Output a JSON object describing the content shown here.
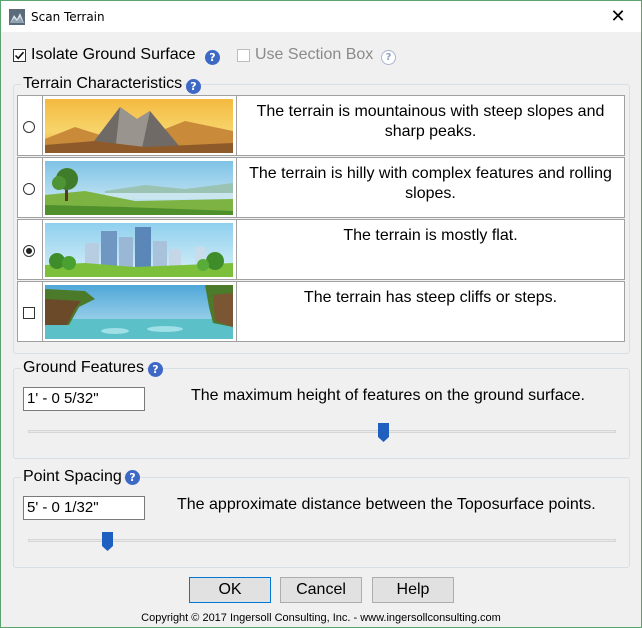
{
  "window": {
    "title": "Scan Terrain",
    "close_glyph": "✕"
  },
  "options": {
    "isolate_ground": {
      "label": "Isolate Ground Surface",
      "checked": true,
      "help": "?"
    },
    "section_box": {
      "label": "Use Section Box",
      "checked": false,
      "enabled": false,
      "help": "?"
    }
  },
  "terrain": {
    "legend": "Terrain Characteristics",
    "help": "?",
    "rows": [
      {
        "control": "radio",
        "selected": false,
        "image": "mountain-landscape",
        "description": "The terrain is mountainous with steep slopes and sharp peaks."
      },
      {
        "control": "radio",
        "selected": false,
        "image": "hill-landscape",
        "description": "The terrain is hilly with complex features and rolling slopes."
      },
      {
        "control": "radio",
        "selected": true,
        "image": "city-landscape",
        "description": "The terrain is mostly flat."
      },
      {
        "control": "checkbox",
        "selected": false,
        "image": "cliff-landscape",
        "description": "The terrain has steep cliffs or steps."
      }
    ]
  },
  "ground_features": {
    "legend": "Ground Features",
    "help": "?",
    "value": "1' - 0 5/32\"",
    "hint": "The maximum height of features on the ground surface.",
    "slider_fraction": 0.605
  },
  "point_spacing": {
    "legend": "Point Spacing",
    "help": "?",
    "value": "5' - 0 1/32\"",
    "hint": "The approximate distance between the Toposurface points.",
    "slider_fraction": 0.135
  },
  "buttons": {
    "ok": "OK",
    "cancel": "Cancel",
    "help": "Help"
  },
  "footer": {
    "copyright": "Copyright © 2017 Ingersoll Consulting, Inc. - www.ingersollconsulting.com"
  },
  "colors": {
    "accent": "#0078d7",
    "help_badge": "#3d68c6",
    "slider_thumb": "#1f5fbf"
  }
}
